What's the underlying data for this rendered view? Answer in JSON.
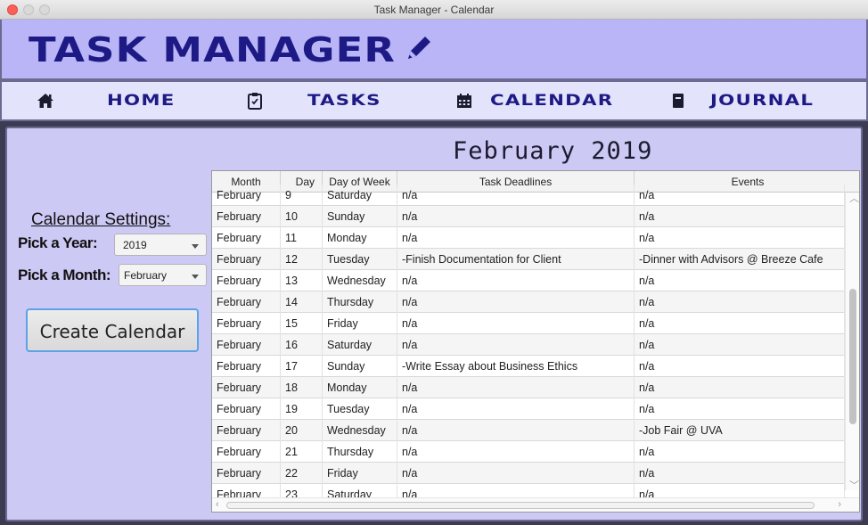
{
  "window": {
    "title": "Task Manager - Calendar"
  },
  "header": {
    "logo": "TASK MANAGER"
  },
  "nav": [
    {
      "label": "HOME",
      "icon": "home-icon"
    },
    {
      "label": "TASKS",
      "icon": "clipboard-icon"
    },
    {
      "label": "CALENDAR",
      "icon": "calendar-icon"
    },
    {
      "label": "JOURNAL",
      "icon": "journal-icon"
    }
  ],
  "main": {
    "month_title": "February 2019",
    "settings_title": "Calendar Settings:",
    "year_label": "Pick a Year:",
    "year_value": "2019",
    "month_label": "Pick a Month:",
    "month_value": "February",
    "create_label": "Create Calendar"
  },
  "table": {
    "columns": [
      "Month",
      "Day",
      "Day of Week",
      "Task Deadlines",
      "Events"
    ],
    "rows": [
      [
        "February",
        "9",
        "Saturday",
        "n/a",
        "n/a"
      ],
      [
        "February",
        "10",
        "Sunday",
        "n/a",
        "n/a"
      ],
      [
        "February",
        "11",
        "Monday",
        "n/a",
        "n/a"
      ],
      [
        "February",
        "12",
        "Tuesday",
        "-Finish Documentation for Client",
        "-Dinner with Advisors @ Breeze Cafe"
      ],
      [
        "February",
        "13",
        "Wednesday",
        "n/a",
        "n/a"
      ],
      [
        "February",
        "14",
        "Thursday",
        "n/a",
        "n/a"
      ],
      [
        "February",
        "15",
        "Friday",
        "n/a",
        "n/a"
      ],
      [
        "February",
        "16",
        "Saturday",
        "n/a",
        "n/a"
      ],
      [
        "February",
        "17",
        "Sunday",
        "-Write Essay about Business Ethics",
        "n/a"
      ],
      [
        "February",
        "18",
        "Monday",
        "n/a",
        "n/a"
      ],
      [
        "February",
        "19",
        "Tuesday",
        "n/a",
        "n/a"
      ],
      [
        "February",
        "20",
        "Wednesday",
        "n/a",
        "-Job Fair @ UVA"
      ],
      [
        "February",
        "21",
        "Thursday",
        "n/a",
        "n/a"
      ],
      [
        "February",
        "22",
        "Friday",
        "n/a",
        "n/a"
      ],
      [
        "February",
        "23",
        "Saturday",
        "n/a",
        "n/a"
      ]
    ]
  },
  "colors": {
    "header_bg": "#b9b5f7",
    "nav_bg": "#e3e3fb",
    "main_bg": "#cdc9f5",
    "brand": "#1e1a85"
  }
}
